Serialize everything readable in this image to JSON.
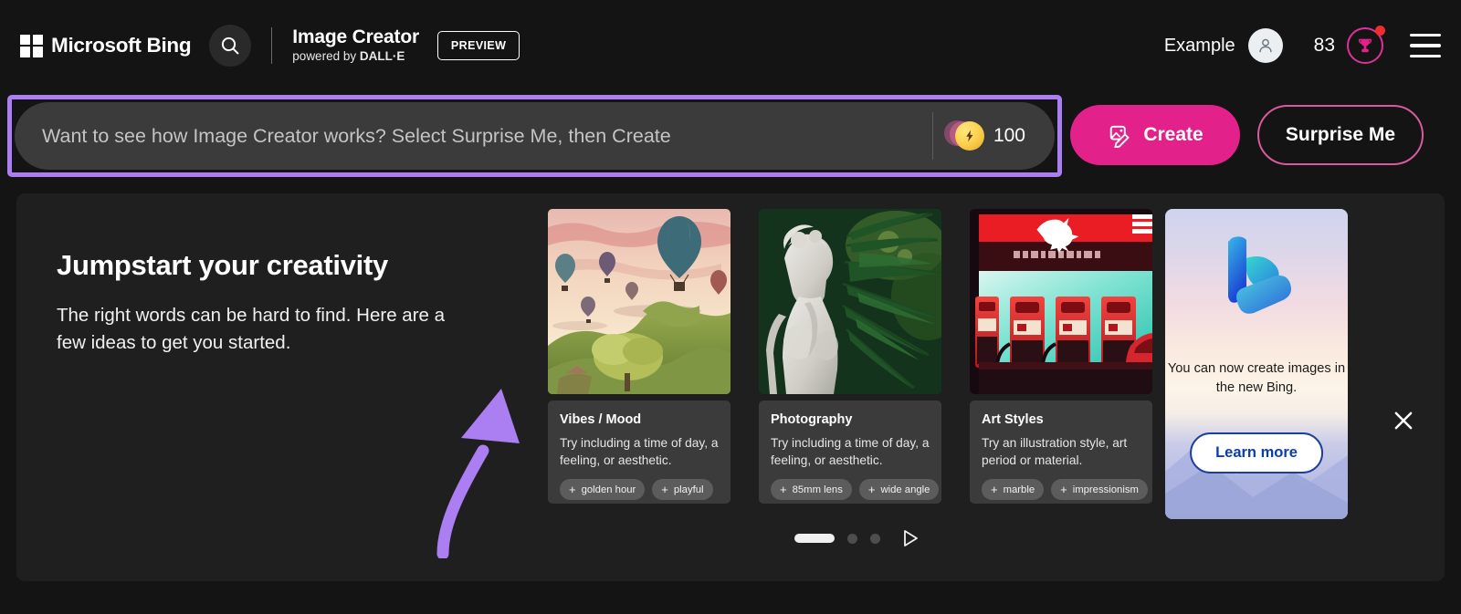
{
  "header": {
    "brand": "Microsoft Bing",
    "search_icon": "search-icon",
    "ms_logo_icon": "microsoft-squares-logo-icon",
    "app_title": "Image Creator",
    "app_subtitle_prefix": "powered by ",
    "app_subtitle_brand": "DALL·E",
    "preview_badge": "PREVIEW",
    "user_name": "Example",
    "avatar_icon": "user-avatar-icon",
    "rewards_count": "83",
    "rewards_icon": "rewards-trophy-icon",
    "notification_dot": "notification-badge-dot",
    "menu_icon": "hamburger-menu-icon"
  },
  "prompt": {
    "placeholder": "Want to see how Image Creator works? Select Surprise Me, then Create",
    "value": "",
    "boost_icon": "boost-coin-icon",
    "boost_count": "100",
    "highlight_color": "#ab7ef2"
  },
  "actions": {
    "create_label": "Create",
    "create_icon": "create-image-pen-icon",
    "create_color": "#e2218b",
    "surprise_label": "Surprise Me",
    "surprise_border_color": "#d85a9c"
  },
  "panel": {
    "title": "Jumpstart your creativity",
    "subtitle": "The right words can be hard to find. Here are a few ideas to get you started.",
    "arrow_icon": "curved-up-arrow-annotation",
    "arrow_color": "#ab7ef2",
    "close_icon": "close-icon",
    "cards": [
      {
        "thumb_icon": "hot-air-balloons-landscape-thumbnail",
        "heading": "Vibes / Mood",
        "description": "Try including a time of day, a feeling, or aesthetic.",
        "chips": [
          "golden hour",
          "playful"
        ]
      },
      {
        "thumb_icon": "marble-statue-palm-leaves-thumbnail",
        "heading": "Photography",
        "description": "Try including a time of day, a feeling, or aesthetic.",
        "chips": [
          "85mm lens",
          "wide angle"
        ]
      },
      {
        "thumb_icon": "neon-gas-station-thumbnail",
        "heading": "Art Styles",
        "description": "Try an illustration style, art period or material.",
        "chips": [
          "marble",
          "impressionism"
        ]
      }
    ],
    "promo": {
      "logo_icon": "bing-logo-icon",
      "text": "You can now create images in the new Bing.",
      "button_label": "Learn more"
    },
    "pager": {
      "active_index": 0,
      "total": 3,
      "next_icon": "play-next-icon"
    }
  }
}
